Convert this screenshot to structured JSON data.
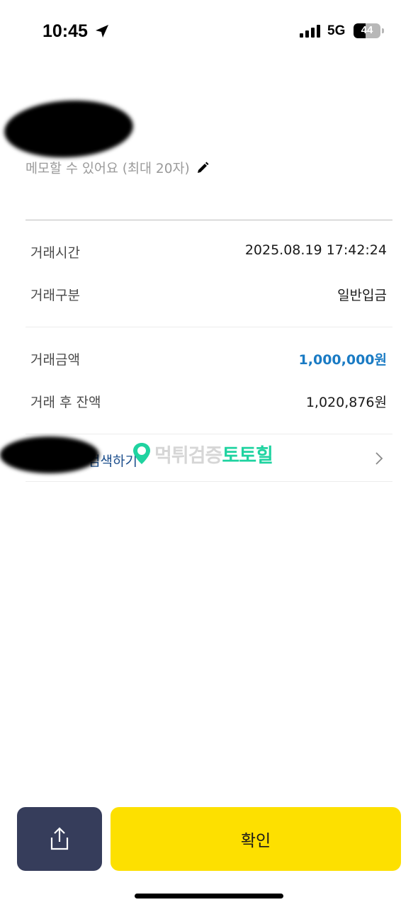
{
  "status_bar": {
    "time": "10:45",
    "network": "5G",
    "battery_percent": "44",
    "battery_level": 0.44
  },
  "memo": {
    "placeholder": "메모할 수 있어요 (최대 20자)"
  },
  "transaction": {
    "time_label": "거래시간",
    "time_value": "2025.08.19 17:42:24",
    "type_label": "거래구분",
    "type_value": "일반입금",
    "amount_label": "거래금액",
    "amount_value": "1,000,000원",
    "balance_label": "거래 후 잔액",
    "balance_value": "1,020,876원"
  },
  "search": {
    "label": "검색하기"
  },
  "watermark": {
    "text_gray": "먹튀검증",
    "text_green": "토토힐"
  },
  "actions": {
    "confirm_label": "확인"
  },
  "colors": {
    "amount": "#1a7bc4",
    "confirm_bg": "#fde000",
    "share_bg": "#363d5b",
    "watermark_green": "#1fd3a0"
  }
}
